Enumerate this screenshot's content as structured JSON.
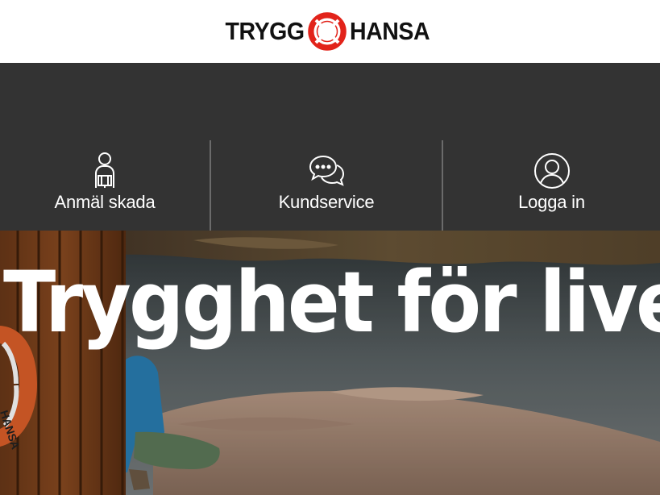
{
  "brand": {
    "left_word": "TRYGG",
    "right_word": "HANSA",
    "logo_color": "#e2231a",
    "text_color": "#111111"
  },
  "nav": {
    "items": [
      {
        "label": "Anmäl skada",
        "icon": "person-injury-icon"
      },
      {
        "label": "Kundservice",
        "icon": "chat-bubbles-icon"
      },
      {
        "label": "Logga in",
        "icon": "user-circle-icon"
      }
    ]
  },
  "hero": {
    "title": "Trygghet för livet",
    "buoy_text": "HANSA"
  },
  "colors": {
    "header_bg": "#ffffff",
    "dark_bg": "#333333",
    "divider": "#6b6b6b",
    "nav_text": "#ffffff"
  }
}
